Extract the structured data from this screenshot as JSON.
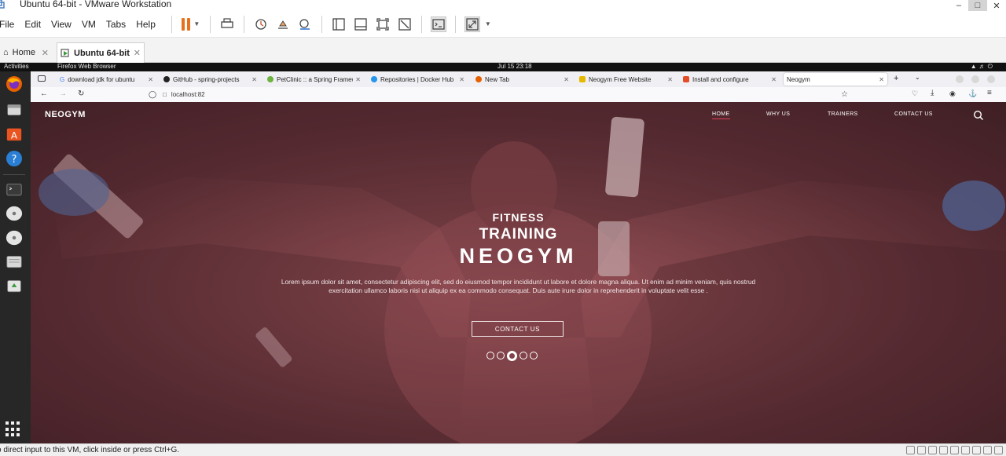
{
  "window": {
    "title": "Ubuntu 64-bit - VMware Workstation"
  },
  "menubar": {
    "items": [
      "File",
      "Edit",
      "View",
      "VM",
      "Tabs",
      "Help"
    ]
  },
  "vm_tabs": [
    {
      "label": "Home"
    },
    {
      "label": "Ubuntu 64-bit"
    }
  ],
  "gnome": {
    "activities": "Activities",
    "app_name": "Firefox Web Browser",
    "clock": "Jul 15  23:18"
  },
  "browser": {
    "tabs": [
      {
        "label": "download jdk for ubuntu",
        "color": "#4285f4"
      },
      {
        "label": "GitHub - spring-projects",
        "color": "#222222"
      },
      {
        "label": "PetClinic :: a Spring Framework",
        "color": "#6db33f"
      },
      {
        "label": "Repositories | Docker Hub",
        "color": "#2496ed"
      },
      {
        "label": "New Tab",
        "color": "#e66000"
      },
      {
        "label": "Neogym Free Website",
        "color": "#e6b800"
      },
      {
        "label": "Install and configure",
        "color": "#e34c26"
      },
      {
        "label": "Neogym",
        "color": "#ffffff"
      }
    ],
    "url": "localhost:82"
  },
  "site": {
    "brand": "NEOGYM",
    "nav": [
      "HOME",
      "WHY US",
      "TRAINERS",
      "CONTACT US"
    ],
    "hero": {
      "kicker": "FITNESS",
      "title": "TRAINING",
      "brand": "NEOGYM",
      "text": "Lorem ipsum dolor sit amet, consectetur adipiscing elit, sed do eiusmod tempor incididunt ut labore et dolore magna aliqua. Ut enim ad minim veniam, quis nostrud exercitation ullamco laboris nisi ut aliquip ex ea commodo consequat. Duis aute irure dolor in reprehenderit in voluptate velit esse .",
      "cta": "CONTACT US"
    },
    "slider": {
      "count": 5,
      "active_index": 2
    }
  },
  "status": {
    "message": "o direct input to this VM, click inside or press Ctrl+G."
  },
  "colors": {
    "overlay": "#6e3a40",
    "accent": "#e0435a",
    "vm_pause": "#e8711c"
  }
}
